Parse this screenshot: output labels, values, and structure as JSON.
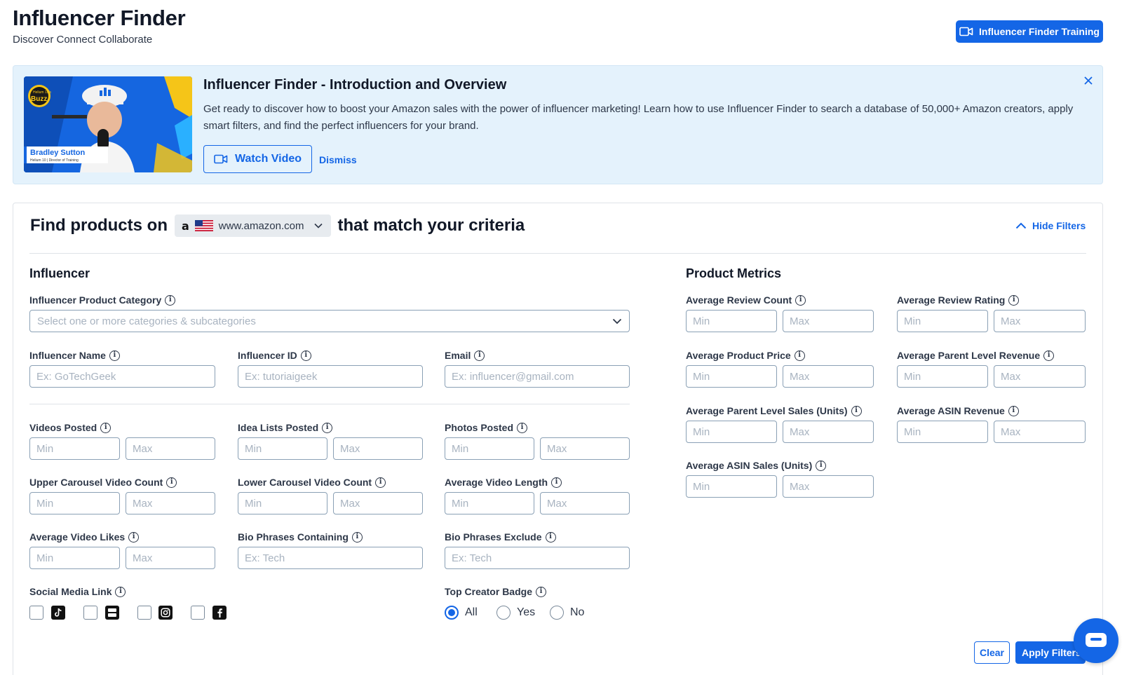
{
  "header": {
    "title": "Influencer Finder",
    "subtitle": "Discover Connect Collaborate",
    "training_button": "Influencer Finder Training"
  },
  "banner": {
    "title": "Influencer Finder - Introduction and Overview",
    "text": "Get ready to discover how to boost your Amazon sales with the power of influencer marketing! Learn how to use Influencer Finder to search a database of 50,000+ Amazon creators, apply smart filters, and find the perfect influencers for your brand.",
    "watch_button": "Watch Video",
    "dismiss": "Dismiss",
    "close_icon": "close-icon",
    "thumbnail": {
      "badge": "Buzz",
      "badge_small": "Helium 10's",
      "presenter_name": "Bradley Sutton",
      "presenter_role": "Helium 10 | Director of Training"
    }
  },
  "finder": {
    "heading_prefix": "Find products on",
    "marketplace": "www.amazon.com",
    "marketplace_letter": "a",
    "heading_suffix": "that match your criteria",
    "hide_filters": "Hide Filters"
  },
  "influencer": {
    "title": "Influencer",
    "category": {
      "label": "Influencer Product Category",
      "placeholder": "Select one or more categories & subcategories"
    },
    "name": {
      "label": "Influencer Name",
      "placeholder": "Ex: GoTechGeek"
    },
    "id": {
      "label": "Influencer ID",
      "placeholder": "Ex: tutoriaigeek"
    },
    "email": {
      "label": "Email",
      "placeholder": "Ex: influencer@gmail.com"
    },
    "videos_posted": {
      "label": "Videos Posted"
    },
    "idea_lists_posted": {
      "label": "Idea Lists Posted"
    },
    "photos_posted": {
      "label": "Photos Posted"
    },
    "upper_carousel": {
      "label": "Upper Carousel Video Count"
    },
    "lower_carousel": {
      "label": "Lower Carousel Video Count"
    },
    "avg_video_length": {
      "label": "Average Video Length"
    },
    "avg_video_likes": {
      "label": "Average Video Likes"
    },
    "bio_containing": {
      "label": "Bio Phrases Containing",
      "placeholder": "Ex: Tech"
    },
    "bio_exclude": {
      "label": "Bio Phrases Exclude",
      "placeholder": "Ex: Tech"
    },
    "social_media": {
      "label": "Social Media Link",
      "icons": [
        "tiktok-icon",
        "youtube-icon",
        "instagram-icon",
        "facebook-icon"
      ]
    },
    "top_creator": {
      "label": "Top Creator Badge",
      "options": [
        "All",
        "Yes",
        "No"
      ],
      "selected": "All"
    }
  },
  "metrics": {
    "title": "Product Metrics",
    "avg_review_count": {
      "label": "Average Review Count"
    },
    "avg_review_rating": {
      "label": "Average Review Rating"
    },
    "avg_product_price": {
      "label": "Average Product Price"
    },
    "avg_parent_revenue": {
      "label": "Average Parent Level Revenue"
    },
    "avg_parent_sales": {
      "label": "Average Parent Level Sales (Units)"
    },
    "avg_asin_revenue": {
      "label": "Average ASIN Revenue"
    },
    "avg_asin_sales": {
      "label": "Average ASIN Sales (Units)"
    }
  },
  "placeholders": {
    "min": "Min",
    "max": "Max"
  },
  "actions": {
    "clear": "Clear",
    "apply": "Apply Filters"
  },
  "colors": {
    "accent": "#1466e6",
    "banner_bg": "#e4f2fc"
  }
}
